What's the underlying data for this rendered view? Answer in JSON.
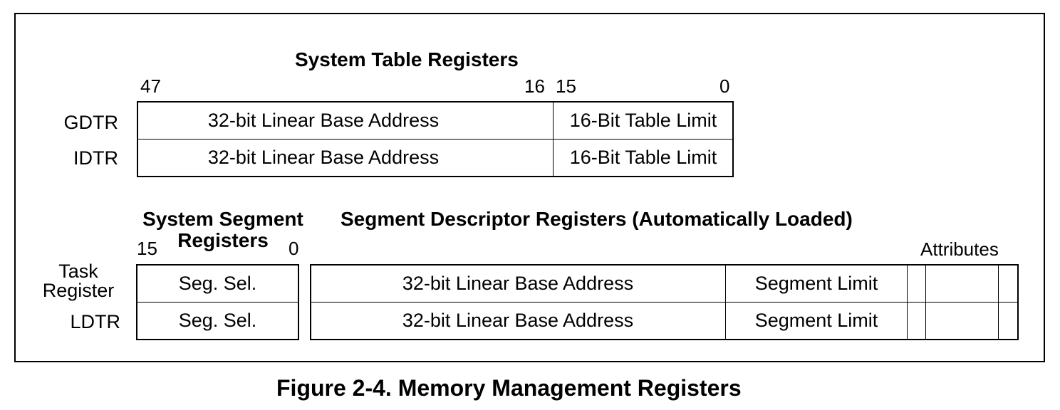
{
  "system_table": {
    "title": "System Table Registers",
    "bits": {
      "b47": "47",
      "b16": "16",
      "b15": "15",
      "b0": "0"
    },
    "rows": [
      {
        "label": "GDTR",
        "base": "32-bit Linear Base Address",
        "limit": "16-Bit Table Limit"
      },
      {
        "label": "IDTR",
        "base": "32-bit Linear Base Address",
        "limit": "16-Bit Table Limit"
      }
    ]
  },
  "system_segment": {
    "title_line1": "System Segment",
    "title_line2": "Registers",
    "bit_high": "15",
    "bit_low": "0",
    "rows": [
      {
        "label_line1": "Task",
        "label_line2": "Register",
        "selector": "Seg. Sel."
      },
      {
        "label": "LDTR",
        "selector": "Seg. Sel."
      }
    ]
  },
  "descriptor": {
    "title": "Segment Descriptor Registers (Automatically Loaded)",
    "attributes_label": "Attributes",
    "rows": [
      {
        "base": "32-bit Linear Base Address",
        "limit": "Segment Limit"
      },
      {
        "base": "32-bit Linear Base Address",
        "limit": "Segment Limit"
      }
    ]
  },
  "caption": "Figure 2-4.  Memory Management Registers"
}
